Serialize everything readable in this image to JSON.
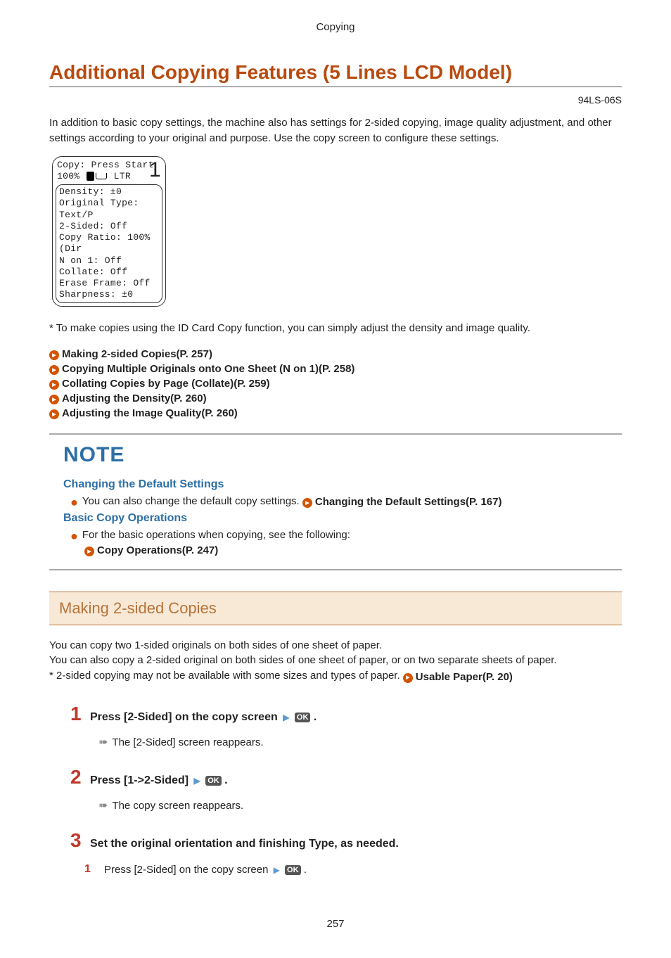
{
  "header": {
    "section": "Copying"
  },
  "title": "Additional Copying Features (5 Lines LCD Model)",
  "doc_code": "94LS-06S",
  "intro": "In addition to basic copy settings, the machine also has settings for 2-sided copying, image quality adjustment, and other settings according to your original and purpose. Use the copy screen to configure these settings.",
  "lcd": {
    "line1": "Copy: Press Start",
    "line2a": "100%",
    "line2b": "LTR",
    "count": "1",
    "rows": [
      "Density: ±0",
      "Original Type: Text/P",
      "2-Sided: Off",
      "Copy Ratio: 100% (Dir",
      "N on 1: Off",
      "Collate: Off",
      "Erase Frame: Off",
      "Sharpness: ±0"
    ]
  },
  "id_note": "* To make copies using the ID Card Copy function, you can simply adjust the density and image quality.",
  "links": [
    "Making 2-sided Copies(P. 257)",
    "Copying Multiple Originals onto One Sheet (N on 1)(P. 258)",
    "Collating Copies by Page (Collate)(P. 259)",
    "Adjusting the Density(P. 260)",
    "Adjusting the Image Quality(P. 260)"
  ],
  "note": {
    "title": "NOTE",
    "sub1": "Changing the Default Settings",
    "line1_pre": "You can also change the default copy settings. ",
    "line1_link": "Changing the Default Settings(P. 167)",
    "sub2": "Basic Copy Operations",
    "line2": "For the basic operations when copying, see the following:",
    "line2_link": "Copy Operations(P. 247)"
  },
  "section": {
    "heading": "Making 2-sided Copies",
    "body_l1": "You can copy two 1-sided originals on both sides of one sheet of paper.",
    "body_l2": "You can also copy a 2-sided original on both sides of one sheet of paper, or on two separate sheets of paper.",
    "body_l3_pre": "* 2-sided copying may not be available with some sizes and types of paper. ",
    "body_l3_link": "Usable Paper(P. 20)",
    "step1": "Press [2-Sided] on the copy screen",
    "step1_sub": "The [2-Sided] screen reappears.",
    "step2": "Press [1->2-Sided]",
    "step2_sub": "The copy screen reappears.",
    "step3": "Set the original orientation and finishing Type, as needed.",
    "sub_step1": "Press [2-Sided] on the copy screen"
  },
  "page_number": "257",
  "ok_label": "OK"
}
